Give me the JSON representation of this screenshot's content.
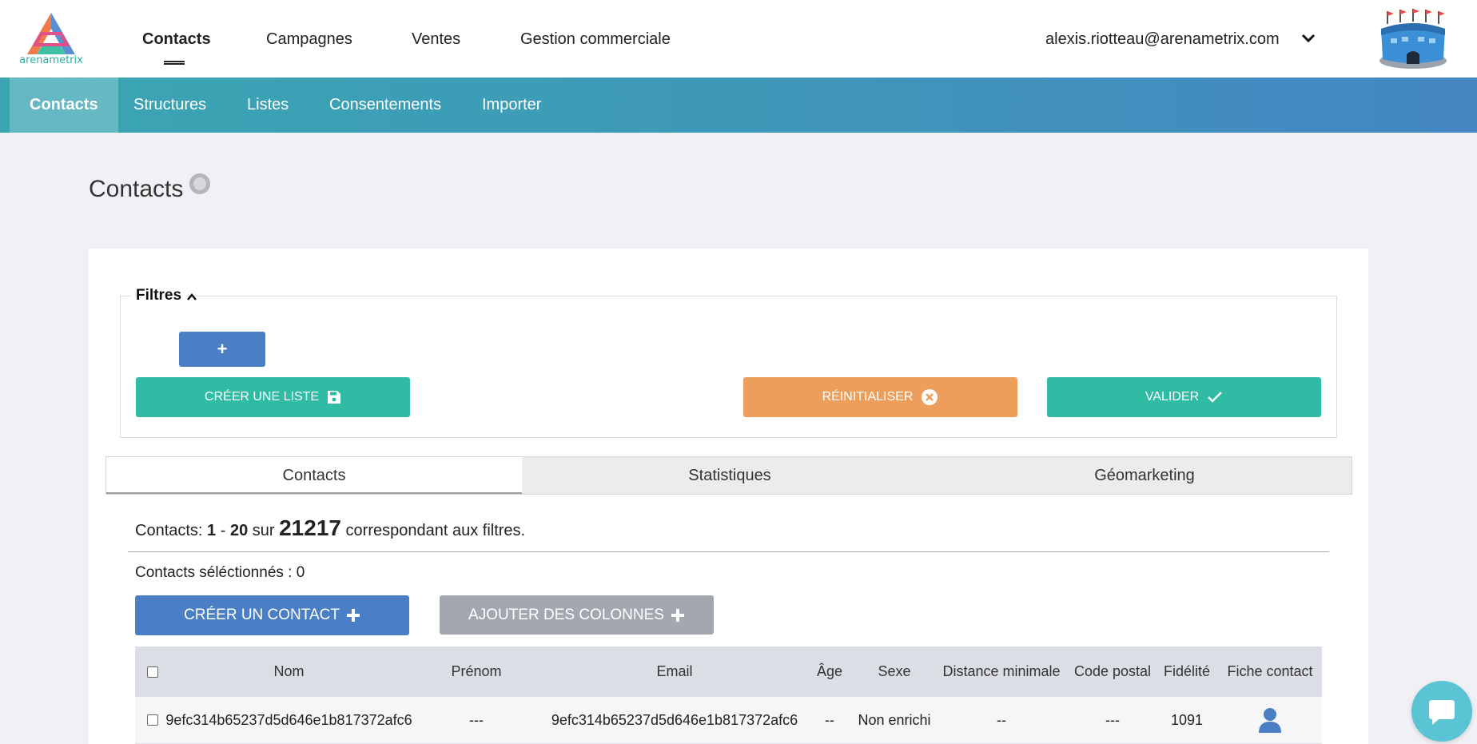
{
  "brand": {
    "logo_text": "arenametrix"
  },
  "main_nav": {
    "items": [
      {
        "label": "Contacts"
      },
      {
        "label": "Campagnes"
      },
      {
        "label": "Ventes"
      },
      {
        "label": "Gestion commerciale"
      }
    ]
  },
  "user": {
    "email": "alexis.riotteau@arenametrix.com"
  },
  "sub_nav": {
    "items": [
      {
        "label": "Contacts"
      },
      {
        "label": "Structures"
      },
      {
        "label": "Listes"
      },
      {
        "label": "Consentements"
      },
      {
        "label": "Importer"
      }
    ]
  },
  "page": {
    "title": "Contacts"
  },
  "filters": {
    "legend": "Filtres",
    "add_label": "+",
    "create_list_label": "CRÉER UNE LISTE",
    "reset_label": "RÉINITIALISER",
    "validate_label": "VALIDER"
  },
  "tabs": [
    {
      "label": "Contacts"
    },
    {
      "label": "Statistiques"
    },
    {
      "label": "Géomarketing"
    }
  ],
  "results": {
    "prefix": "Contacts: ",
    "from": "1",
    "dash": " - ",
    "to": "20",
    "sur": " sur ",
    "total": "21217",
    "suffix": " correspondant aux filtres.",
    "selected_text": "Contacts séléctionnés : 0"
  },
  "actions": {
    "create_contact_label": "CRÉER UN CONTACT",
    "add_columns_label": "AJOUTER DES COLONNES"
  },
  "table": {
    "headers": {
      "nom": "Nom",
      "prenom": "Prénom",
      "email": "Email",
      "age": "Âge",
      "sexe": "Sexe",
      "distance": "Distance minimale",
      "code_postal": "Code postal",
      "fidelite": "Fidélité",
      "fiche": "Fiche contact"
    },
    "rows": [
      {
        "nom": "9efc314b65237d5d646e1b817372afc6",
        "prenom": "---",
        "email": "9efc314b65237d5d646e1b817372afc6",
        "age": "--",
        "sexe": "Non enrichi",
        "distance": "--",
        "code_postal": "---",
        "fidelite": "1091"
      }
    ]
  },
  "colors": {
    "accent_teal": "#2fbba4",
    "accent_blue": "#4a7fc6",
    "accent_orange": "#ed9e5b",
    "subnav_start": "#3aa6b2",
    "subnav_end": "#4586c3"
  }
}
